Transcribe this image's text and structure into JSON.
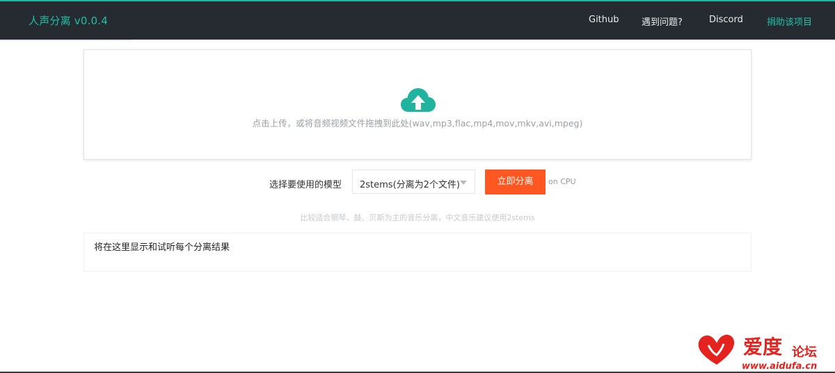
{
  "header": {
    "title": "人声分离 v0.0.4",
    "nav": [
      "Github",
      "遇到问题?",
      "Discord",
      "捐助该项目"
    ],
    "accent_color": "#1fbfa7",
    "background_color": "#252b31"
  },
  "upload": {
    "icon": "cloud-upload-icon",
    "hint": "点击上传，或将音频视频文件拖拽到此处(wav,mp3,flac,mp4,mov,mkv,avi,mpeg)"
  },
  "controls": {
    "model_label": "选择要使用的模型",
    "model_selected": "2stems(分离为2个文件)",
    "submit_label": "立即分离",
    "submit_color": "#ff5722",
    "device": "on CPU"
  },
  "tip": "比较适合钢琴、鼓、贝斯为主的音乐分离，中文音乐建议使用2stems",
  "results": {
    "placeholder": "将在这里显示和试听每个分离结果"
  },
  "watermark": {
    "text_main": "爱度",
    "text_sub": "论坛",
    "url": "www.aidufa.cn"
  }
}
